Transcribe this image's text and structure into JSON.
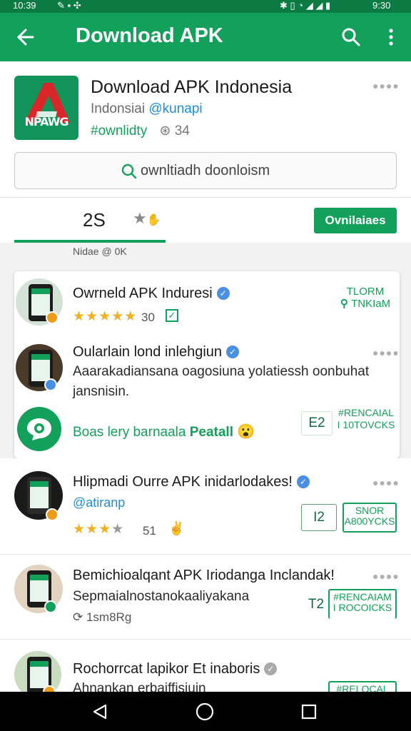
{
  "status_bar": {
    "left_text": "10:39",
    "time": "9:30"
  },
  "app_bar": {
    "title": "Download APK"
  },
  "header": {
    "app_title": "Download APK Indonesia",
    "app_icon_label": "NPAWG",
    "developer": "Indonsiai",
    "handle": "@kunapi",
    "hashtag": "#ownlidty",
    "downloads": "34",
    "search_text": "ownltiadh doonloism"
  },
  "tabs": {
    "count": "2S",
    "button_label": "Ovnilaiaes"
  },
  "caption": "Nidae @ 0K",
  "card": {
    "items": [
      {
        "name": "Owrneld APK Induresi",
        "rating": "30",
        "tag_line1": "TLORM",
        "tag_line2": "TNKIaM"
      },
      {
        "name": "Oularlain lond inlehgiun",
        "desc_line1": "Aaarakadiansana oagosiuna yolatiessh oonbuhat",
        "desc_line2": "jansnisin."
      },
      {
        "name_prefix": "Boas lery barnaala",
        "name_accent": "Peatall",
        "num": "E2",
        "tag_line1": "#RENCAIAL",
        "tag_line2": "I 10TOVCKS"
      }
    ]
  },
  "rows": [
    {
      "name": "Hlipmadi Ourre APK inidarlodakes!",
      "handle": "@atiranp",
      "rating": "51",
      "num": "I2",
      "tag_line1": "SNOR",
      "tag_line2": "A800YCKS"
    },
    {
      "name": "Bemichioalqant APK Iriodanga Inclandak!",
      "desc": "Sepmaialnostanokaaliyakana",
      "meta": "1sm8Rg",
      "num": "T2",
      "tag_line1": "#RENCAIAM",
      "tag_line2": "I ROCOICKS"
    },
    {
      "name": "Rochorrcat lapikor Et inaboris",
      "desc": "Ahnankan erbaiffisiuin",
      "tag_line1": "#RELOCAL"
    }
  ],
  "colors": {
    "primary": "#13A05A",
    "status_bar": "#0C7A43",
    "star": "#F2B01E",
    "verified": "#4A90E2"
  }
}
